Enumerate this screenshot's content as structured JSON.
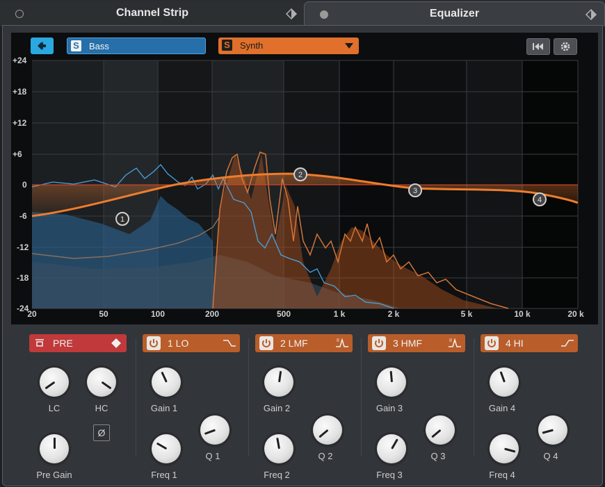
{
  "tabs": [
    {
      "label": "Channel Strip"
    },
    {
      "label": "Equalizer"
    }
  ],
  "toolbar": {
    "bass": {
      "badge": "S",
      "label": "Bass"
    },
    "synth": {
      "badge": "S",
      "label": "Synth"
    }
  },
  "graph": {
    "y_ticks": [
      "+24",
      "+18",
      "+12",
      "+6",
      "0",
      "-6",
      "-12",
      "-18",
      "-24"
    ],
    "x_ticks": [
      "20",
      "50",
      "100",
      "200",
      "500",
      "1 k",
      "2 k",
      "5 k",
      "10 k",
      "20 k"
    ],
    "node_labels": [
      "1",
      "2",
      "3",
      "4"
    ],
    "colors": {
      "eq_curve": "#e8782d",
      "bass_spectrum": "#3a8fd0",
      "synth_spectrum": "#c9652a",
      "zero_line": "#c0392b"
    }
  },
  "pre_section": {
    "label": "PRE",
    "knobs": [
      {
        "label": "LC",
        "rotation": -125
      },
      {
        "label": "HC",
        "rotation": 125
      },
      {
        "label": "Pre Gain",
        "rotation": 0
      }
    ],
    "phase_symbol": "Ø"
  },
  "bands": [
    {
      "label": "1 LO",
      "shape": "low-shelf",
      "knobs": [
        {
          "label": "Gain 1",
          "rotation": -25
        },
        {
          "label": "Q 1",
          "rotation": -110
        },
        {
          "label": "Freq 1",
          "rotation": -60
        }
      ]
    },
    {
      "label": "2 LMF",
      "shape": "peak",
      "knobs": [
        {
          "label": "Gain 2",
          "rotation": 8
        },
        {
          "label": "Q 2",
          "rotation": -130
        },
        {
          "label": "Freq 2",
          "rotation": -10
        }
      ]
    },
    {
      "label": "3 HMF",
      "shape": "peak",
      "knobs": [
        {
          "label": "Gain 3",
          "rotation": -5
        },
        {
          "label": "Q 3",
          "rotation": -130
        },
        {
          "label": "Freq 3",
          "rotation": 30
        }
      ]
    },
    {
      "label": "4 HI",
      "shape": "high-shelf",
      "knobs": [
        {
          "label": "Gain 4",
          "rotation": -20
        },
        {
          "label": "Q 4",
          "rotation": -105
        },
        {
          "label": "Freq 4",
          "rotation": 105
        }
      ]
    }
  ]
}
